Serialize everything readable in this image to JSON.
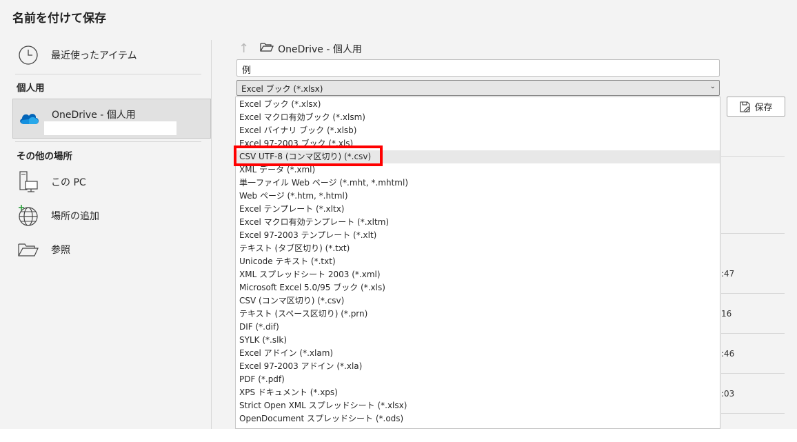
{
  "window": {
    "title": "名前を付けて保存"
  },
  "nav": {
    "recent": "最近使ったアイテム",
    "personal_section": "個人用",
    "onedrive": "OneDrive - 個人用",
    "other_section": "その他の場所",
    "this_pc": "この PC",
    "add_place": "場所の追加",
    "browse": "参照"
  },
  "location": {
    "path": "OneDrive - 個人用"
  },
  "filename": {
    "value": "例"
  },
  "filetype": {
    "selected": "Excel ブック (*.xlsx)",
    "highlighted_index": 4,
    "options": [
      "Excel ブック (*.xlsx)",
      "Excel マクロ有効ブック (*.xlsm)",
      "Excel バイナリ ブック (*.xlsb)",
      "Excel 97-2003 ブック (*.xls)",
      "CSV UTF-8 (コンマ区切り) (*.csv)",
      "XML データ (*.xml)",
      "単一ファイル Web ページ (*.mht, *.mhtml)",
      "Web ページ (*.htm, *.html)",
      "Excel テンプレート (*.xltx)",
      "Excel マクロ有効テンプレート (*.xltm)",
      "Excel 97-2003 テンプレート (*.xlt)",
      "テキスト (タブ区切り) (*.txt)",
      "Unicode テキスト (*.txt)",
      "XML スプレッドシート 2003 (*.xml)",
      "Microsoft Excel 5.0/95 ブック (*.xls)",
      "CSV (コンマ区切り) (*.csv)",
      "テキスト (スペース区切り) (*.prn)",
      "DIF (*.dif)",
      "SYLK (*.slk)",
      "Excel アドイン (*.xlam)",
      "Excel 97-2003 アドイン (*.xla)",
      "PDF (*.pdf)",
      "XPS ドキュメント (*.xps)",
      "Strict Open XML スプレッドシート (*.xlsx)",
      "OpenDocument スプレッドシート (*.ods)"
    ]
  },
  "buttons": {
    "save": "保存"
  },
  "file_list_fragments": [
    ":47",
    "16",
    ":46",
    ":03"
  ],
  "colors": {
    "highlight_border": "#ff0000",
    "panel_bg": "#f3f3f3",
    "onedrive_blue": "#0364b8"
  }
}
